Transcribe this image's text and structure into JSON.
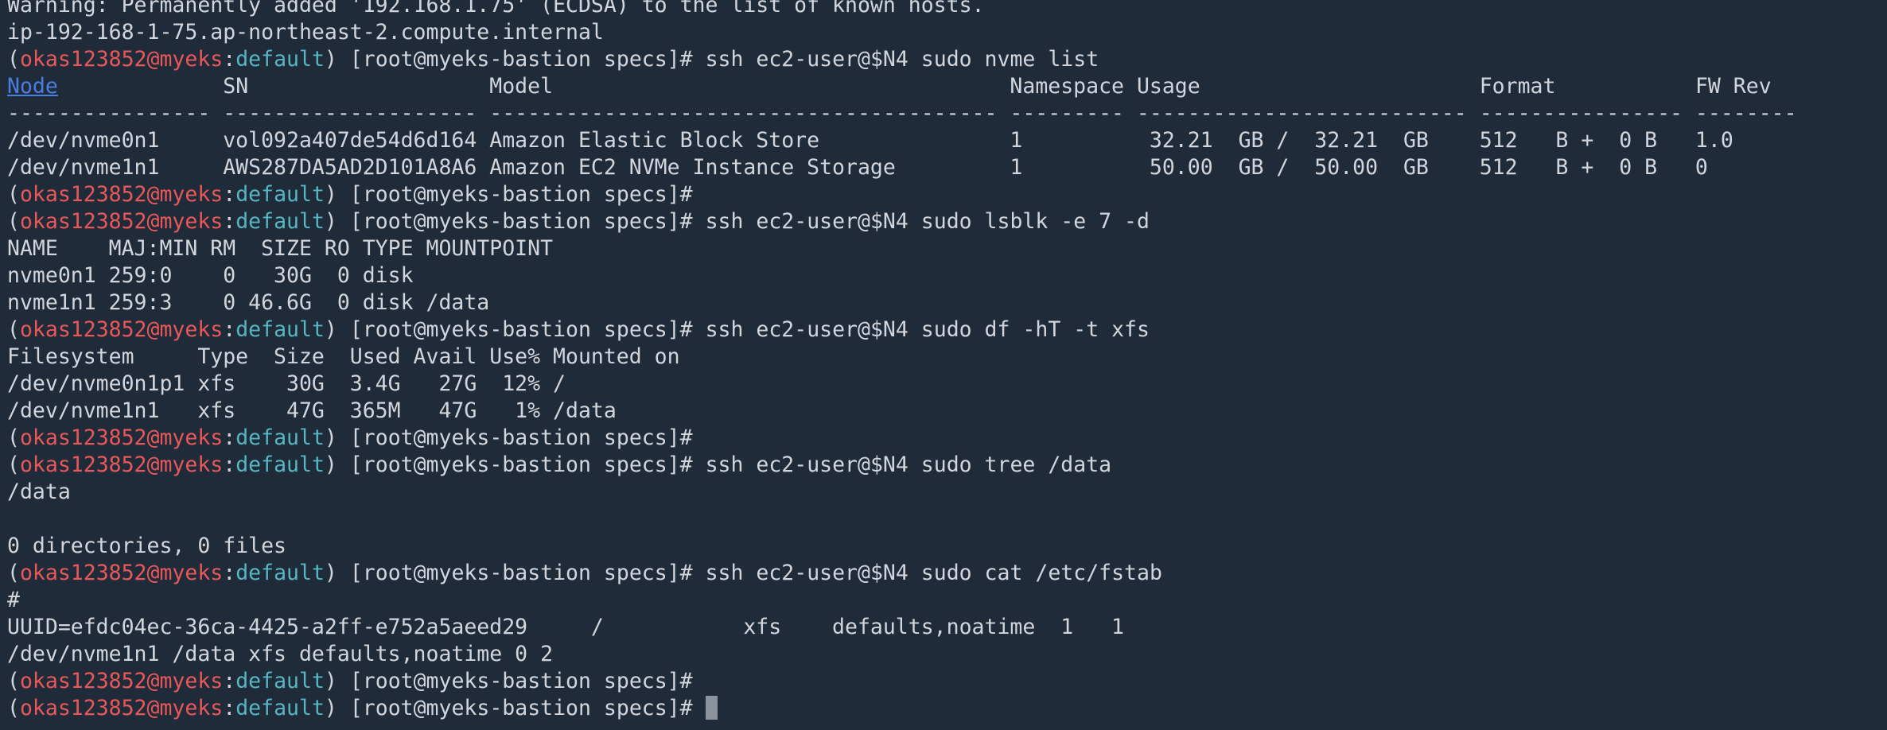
{
  "terminal": {
    "prompt": {
      "user": "okas123852@myeks",
      "context": "default",
      "shell": "[root@myeks-bastion specs]#"
    },
    "lines": [
      {
        "type": "text",
        "text": "Warning: Permanently added '192.168.1.75' (ECDSA) to the list of known hosts."
      },
      {
        "type": "text",
        "text": "ip-192-168-1-75.ap-northeast-2.compute.internal"
      },
      {
        "type": "prompt",
        "cmd": " ssh ec2-user@$N4 sudo nvme list"
      },
      {
        "type": "header",
        "link": "Node",
        "text": "             SN                   Model                                    Namespace Usage                      Format           FW Rev"
      },
      {
        "type": "text",
        "text": "---------------- -------------------- ---------------------------------------- --------- -------------------------- ---------------- --------"
      },
      {
        "type": "text",
        "text": "/dev/nvme0n1     vol092a407de54d6d164 Amazon Elastic Block Store               1          32.21  GB /  32.21  GB    512   B +  0 B   1.0"
      },
      {
        "type": "text",
        "text": "/dev/nvme1n1     AWS287DA5AD2D101A8A6 Amazon EC2 NVMe Instance Storage         1          50.00  GB /  50.00  GB    512   B +  0 B   0"
      },
      {
        "type": "prompt",
        "cmd": ""
      },
      {
        "type": "prompt",
        "cmd": " ssh ec2-user@$N4 sudo lsblk -e 7 -d"
      },
      {
        "type": "text",
        "text": "NAME    MAJ:MIN RM  SIZE RO TYPE MOUNTPOINT"
      },
      {
        "type": "text",
        "text": "nvme0n1 259:0    0   30G  0 disk"
      },
      {
        "type": "text",
        "text": "nvme1n1 259:3    0 46.6G  0 disk /data"
      },
      {
        "type": "prompt",
        "cmd": " ssh ec2-user@$N4 sudo df -hT -t xfs"
      },
      {
        "type": "text",
        "text": "Filesystem     Type  Size  Used Avail Use% Mounted on"
      },
      {
        "type": "text",
        "text": "/dev/nvme0n1p1 xfs    30G  3.4G   27G  12% /"
      },
      {
        "type": "text",
        "text": "/dev/nvme1n1   xfs    47G  365M   47G   1% /data"
      },
      {
        "type": "prompt",
        "cmd": ""
      },
      {
        "type": "prompt",
        "cmd": " ssh ec2-user@$N4 sudo tree /data"
      },
      {
        "type": "text",
        "text": "/data"
      },
      {
        "type": "text",
        "text": ""
      },
      {
        "type": "text",
        "text": "0 directories, 0 files"
      },
      {
        "type": "prompt",
        "cmd": " ssh ec2-user@$N4 sudo cat /etc/fstab"
      },
      {
        "type": "text",
        "text": "#"
      },
      {
        "type": "text",
        "text": "UUID=efdc04ec-36ca-4425-a2ff-e752a5aeed29     /           xfs    defaults,noatime  1   1"
      },
      {
        "type": "text",
        "text": "/dev/nvme1n1 /data xfs defaults,noatime 0 2"
      },
      {
        "type": "prompt",
        "cmd": ""
      },
      {
        "type": "prompt",
        "cmd": " ",
        "cursor": true
      }
    ]
  }
}
